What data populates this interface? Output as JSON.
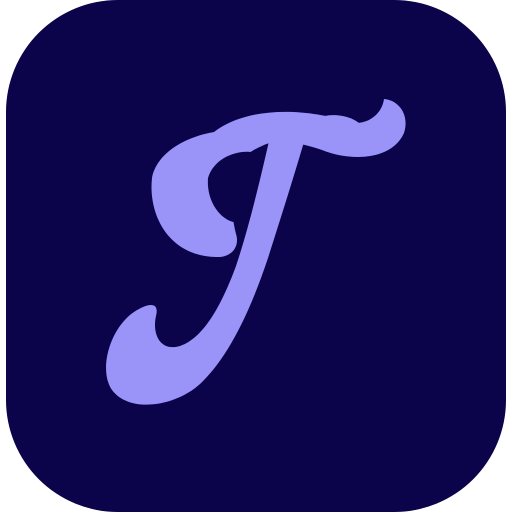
{
  "app_icon": {
    "name": "script-t-app-icon",
    "letter": "T",
    "colors": {
      "background": "#0B044A",
      "glyph": "#9B94F8"
    }
  }
}
